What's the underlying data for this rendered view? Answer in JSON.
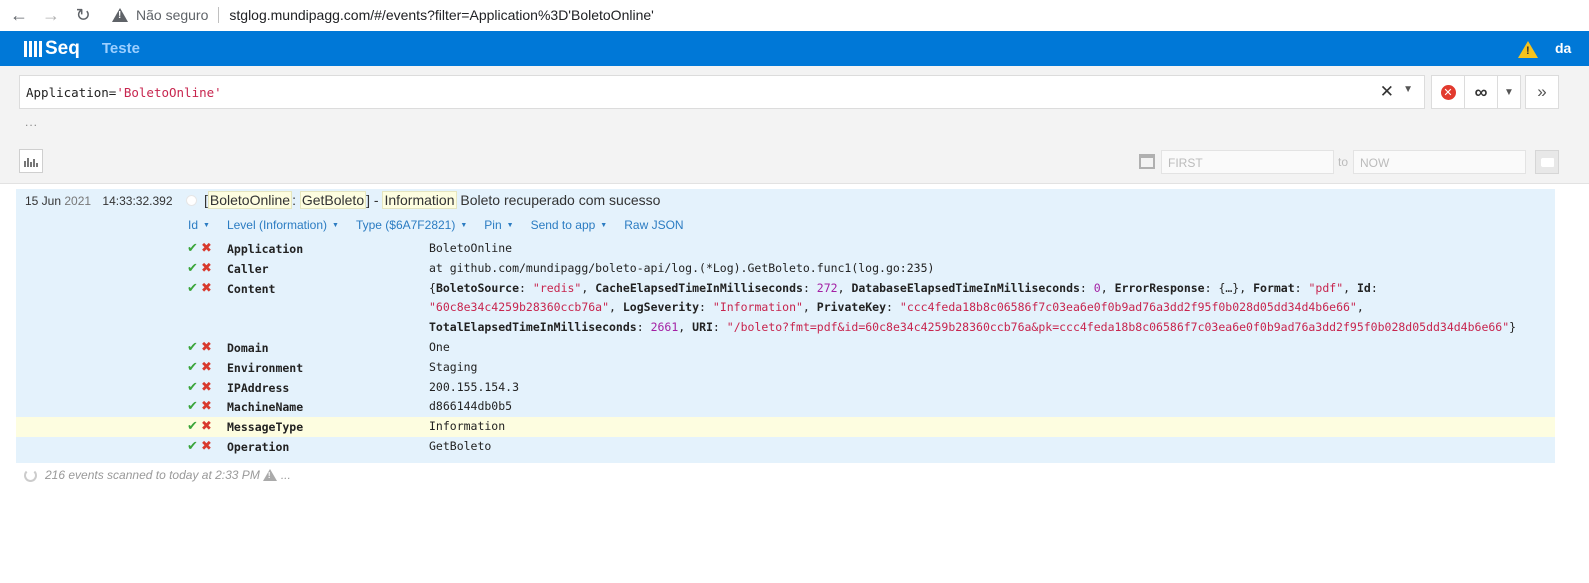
{
  "browser": {
    "not_secure": "Não seguro",
    "url": "stglog.mundipagg.com/#/events?filter=Application%3D'BoletoOnline'"
  },
  "header": {
    "logo": "Seq",
    "workspace": "Teste",
    "user_initial": "da"
  },
  "filter": {
    "query_key": "Application=",
    "query_value": "'BoletoOnline'",
    "more": "...",
    "date_from_placeholder": "FIRST",
    "date_to_label": "to",
    "date_to_placeholder": "NOW"
  },
  "event": {
    "day_month": "15 Jun",
    "year": "2021",
    "time": "14:33:32.392",
    "msg_open": "[",
    "msg_app": "BoletoOnline",
    "msg_colon": ": ",
    "msg_op": "GetBoleto",
    "msg_mid": "] - ",
    "msg_level": "Information",
    "msg_text": " Boleto recuperado com sucesso",
    "actions": [
      "Id",
      "Level (Information)",
      "Type ($6A7F2821)",
      "Pin",
      "Send to app",
      "Raw JSON"
    ],
    "properties": [
      {
        "name": "Application",
        "value": "BoletoOnline"
      },
      {
        "name": "Caller",
        "value": "at github.com/mundipagg/boleto-api/log.(*Log).GetBoleto.func1(log.go:235)"
      },
      {
        "name": "Content",
        "value": ""
      },
      {
        "name": "Domain",
        "value": "One"
      },
      {
        "name": "Environment",
        "value": "Staging"
      },
      {
        "name": "IPAddress",
        "value": "200.155.154.3"
      },
      {
        "name": "MachineName",
        "value": "d866144db0b5"
      },
      {
        "name": "MessageType",
        "value": "Information"
      },
      {
        "name": "Operation",
        "value": "GetBoleto"
      }
    ],
    "content": {
      "k_boleto_source": "BoletoSource",
      "v_boleto_source": "\"redis\"",
      "k_cache_elapsed": "CacheElapsedTimeInMilliseconds",
      "v_cache_elapsed": "272",
      "k_db_elapsed": "DatabaseElapsedTimeInMilliseconds",
      "v_db_elapsed": "0",
      "k_error_response": "ErrorResponse",
      "v_error_response": "{…}",
      "k_format": "Format",
      "v_format": "\"pdf\"",
      "k_id": "Id",
      "v_id": "\"60c8e34c4259b28360ccb76a\"",
      "k_log_severity": "LogSeverity",
      "v_log_severity": "\"Information\"",
      "k_private_key": "PrivateKey",
      "v_private_key": "\"ccc4feda18b8c06586f7c03ea6e0f0b9ad76a3dd2f95f0b028d05dd34d4b6e66\"",
      "k_total_elapsed": "TotalElapsedTimeInMilliseconds",
      "v_total_elapsed": "2661",
      "k_uri": "URI",
      "v_uri": "\"/boleto?fmt=pdf&id=60c8e34c4259b28360ccb76a&pk=ccc4feda18b8c06586f7c03ea6e0f0b9ad76a3dd2f95f0b028d05dd34d4b6e66\""
    }
  },
  "status": {
    "text": "216 events scanned to today at 2:33 PM",
    "more": "..."
  },
  "colors": {
    "header_blue": "#0078d7",
    "event_bg": "#e4f2fc",
    "link": "#2b7cc2",
    "string": "#c7254e",
    "number": "#a31fa3",
    "check": "#3aa53a",
    "cross": "#d83a2e"
  }
}
